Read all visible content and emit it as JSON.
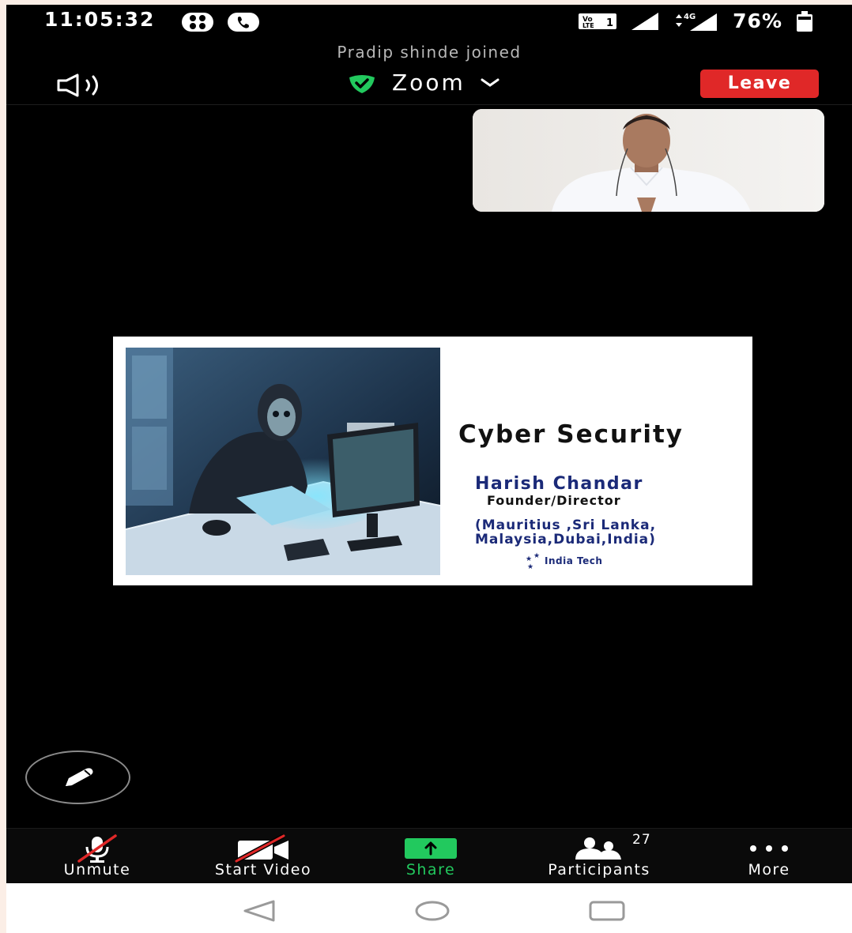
{
  "status_bar": {
    "time": "11:05:32",
    "battery_percent": "76%",
    "network_label": "4G",
    "volte_label": "VoLTE 1",
    "icons": [
      "grid-app-icon",
      "phone-call-icon",
      "volte-icon",
      "signal-icon",
      "data-arrows-icon",
      "battery-icon"
    ]
  },
  "notification": "Pradip shinde joined",
  "top_bar": {
    "title": "Zoom",
    "leave_label": "Leave",
    "icons": [
      "speaker-icon",
      "shield-check-icon",
      "chevron-down-icon"
    ]
  },
  "slide": {
    "title": "Cyber Security",
    "presenter_name": "Harish Chandar",
    "presenter_role": "Founder/Director",
    "countries_line1": "(Mauritius ,Sri Lanka,",
    "countries_line2": "Malaysia,Dubai,India)",
    "brand": "India Tech"
  },
  "toolbar": {
    "unmute_label": "Unmute",
    "start_video_label": "Start Video",
    "share_label": "Share",
    "participants_label": "Participants",
    "participants_count": "27",
    "more_label": "More"
  },
  "colors": {
    "leave_red": "#e02828",
    "share_green": "#22c95e",
    "shield_green": "#22c95e",
    "slide_blue": "#1b2a78"
  }
}
